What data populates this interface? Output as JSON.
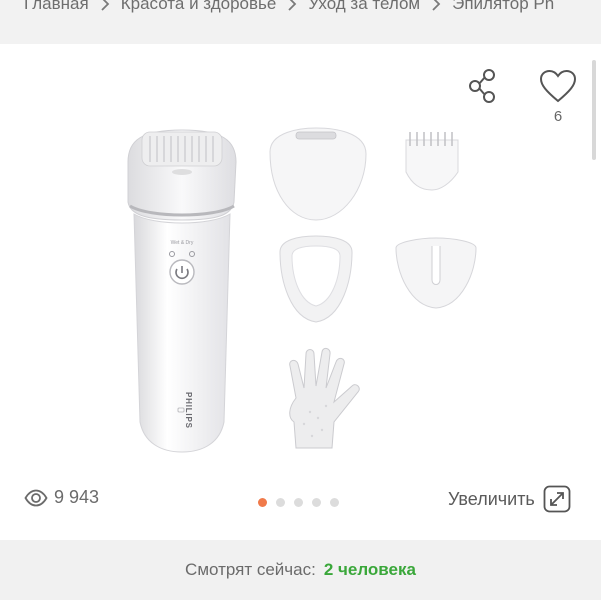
{
  "breadcrumb": {
    "items": [
      "Главная",
      "Красота и здоровье",
      "Уход за телом",
      "Эпилятор Ph"
    ]
  },
  "product": {
    "favorites_count": "6",
    "views_count": "9 943",
    "zoom_label": "Увеличить",
    "image_labels": {
      "brand": "PHILIPS",
      "wet_dry": "Wet & Dry"
    },
    "gallery": {
      "total": 5,
      "active_index": 0
    }
  },
  "watching": {
    "label": "Смотрят сейчас:",
    "value": "2 человека"
  },
  "colors": {
    "accent_dot": "#f07a4a",
    "green_text": "#3aa73a",
    "bar_bg": "#f2f2f2"
  },
  "icons": [
    "chevron-right-icon",
    "share-icon",
    "heart-icon",
    "eye-icon",
    "expand-icon"
  ]
}
